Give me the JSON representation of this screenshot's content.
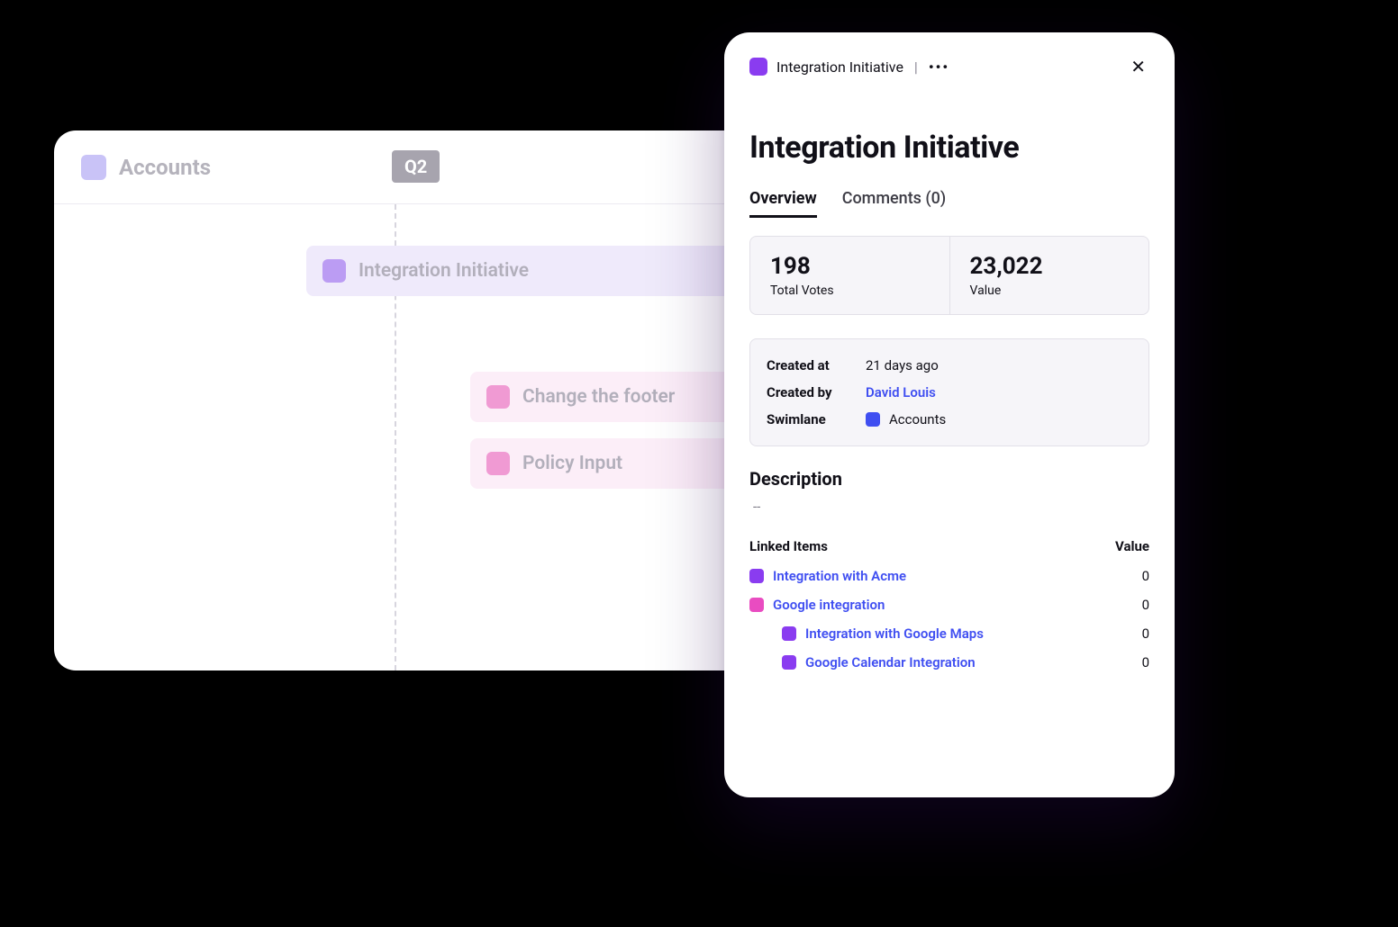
{
  "timeline": {
    "swimlane_label": "Accounts",
    "quarter": "Q2",
    "bars": [
      {
        "label": "Integration Initiative",
        "color": "lilac"
      },
      {
        "label": "Change the footer",
        "color": "pink"
      },
      {
        "label": "Policy Input",
        "color": "pink"
      }
    ]
  },
  "panel": {
    "breadcrumb": "Integration Initiative",
    "title": "Integration Initiative",
    "tabs": {
      "overview": "Overview",
      "comments": "Comments (0)"
    },
    "stats": {
      "votes_value": "198",
      "votes_label": "Total Votes",
      "value_value": "23,022",
      "value_label": "Value"
    },
    "meta": {
      "created_at_label": "Created at",
      "created_at_value": "21 days ago",
      "created_by_label": "Created by",
      "created_by_value": "David Louis",
      "swimlane_label": "Swimlane",
      "swimlane_value": "Accounts"
    },
    "description": {
      "heading": "Description",
      "body": "--"
    },
    "linked": {
      "heading": "Linked Items",
      "value_heading": "Value",
      "items": [
        {
          "name": "Integration with Acme",
          "value": "0",
          "color": "purple",
          "indent": 0
        },
        {
          "name": "Google integration",
          "value": "0",
          "color": "magenta",
          "indent": 0
        },
        {
          "name": "Integration with Google Maps",
          "value": "0",
          "color": "purple",
          "indent": 1
        },
        {
          "name": "Google Calendar Integration",
          "value": "0",
          "color": "purple",
          "indent": 1
        }
      ]
    }
  }
}
